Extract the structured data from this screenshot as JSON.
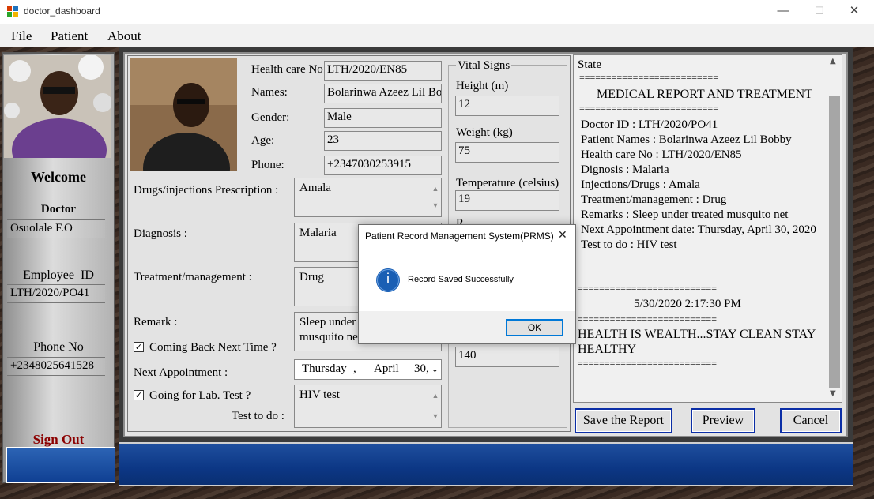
{
  "window": {
    "title": "doctor_dashboard",
    "minimize": "—",
    "maximize": "☐",
    "close": "✕"
  },
  "menu": [
    "File",
    "Patient",
    "About"
  ],
  "sidebar": {
    "welcome": "Welcome",
    "role": "Doctor",
    "doctor_name": "Osuolale F.O",
    "employee_id_label": "Employee_ID",
    "employee_id": "LTH/2020/PO41",
    "phone_label": "Phone No",
    "phone": "+2348025641528",
    "sign_out": "Sign Out"
  },
  "patient": {
    "health_care_label": "Health care No:",
    "health_care_no": "LTH/2020/EN85",
    "names_label": "Names:",
    "names": "Bolarinwa Azeez Lil Bobby",
    "gender_label": "Gender:",
    "gender": "Male",
    "age_label": "Age:",
    "age": "23",
    "phone_label": "Phone:",
    "phone": "+2347030253915"
  },
  "form": {
    "prescription_label": "Drugs/injections Prescription :",
    "prescription": "Amala",
    "diagnosis_label": "Diagnosis :",
    "diagnosis": "Malaria",
    "treatment_label": "Treatment/management :",
    "treatment": "Drug",
    "remark_label": "Remark :",
    "remark_line1": "Sleep under",
    "remark_line2": "musquito net",
    "coming_back_label": "Coming Back Next Time ?",
    "coming_back_checked": true,
    "next_appointment_label": "Next Appointment :",
    "appt_day": "Thursday",
    "appt_sep": ",",
    "appt_month": "April",
    "appt_date": "30,",
    "lab_test_label": "Going for Lab. Test ?",
    "lab_test_checked": true,
    "test_to_do_label": "Test to do :",
    "test_to_do": "HIV test"
  },
  "vitals": {
    "title": "Vital Signs",
    "height_label": "Height (m)",
    "height": "12",
    "weight_label": "Weight (kg)",
    "weight": "75",
    "temperature_label": "Temperature (celsius)",
    "temperature": "19",
    "partial_label": "R",
    "last_value": "140"
  },
  "report": {
    "state_label": "State",
    "divider": "==========================",
    "heading": "MEDICAL REPORT AND TREATMENT",
    "lines": [
      "Doctor ID : LTH/2020/PO41",
      "Patient Names : Bolarinwa Azeez Lil Bobby",
      "Health care No : LTH/2020/EN85",
      "Dignosis : Malaria",
      "Injections/Drugs : Amala",
      "Treatment/management : Drug",
      "Remarks : Sleep under treated musquito net",
      "Next Appointment date: Thursday, April 30, 2020",
      "Test to do : HIV test"
    ],
    "timestamp": "5/30/2020  2:17:30 PM",
    "slogan_line1": "HEALTH IS WEALTH...STAY CLEAN STAY",
    "slogan_line2": "HEALTHY"
  },
  "buttons": {
    "save": "Save the Report",
    "preview": "Preview",
    "cancel": "Cancel"
  },
  "dialog": {
    "title": "Patient Record Management System(PRMS)",
    "message": "Record Saved Successfully",
    "ok": "OK",
    "close": "✕",
    "info_symbol": "i"
  },
  "colors": {
    "accent_blue": "#0b2ea6",
    "sign_out": "#8b0000",
    "info_icon": "#1a5fb4"
  }
}
